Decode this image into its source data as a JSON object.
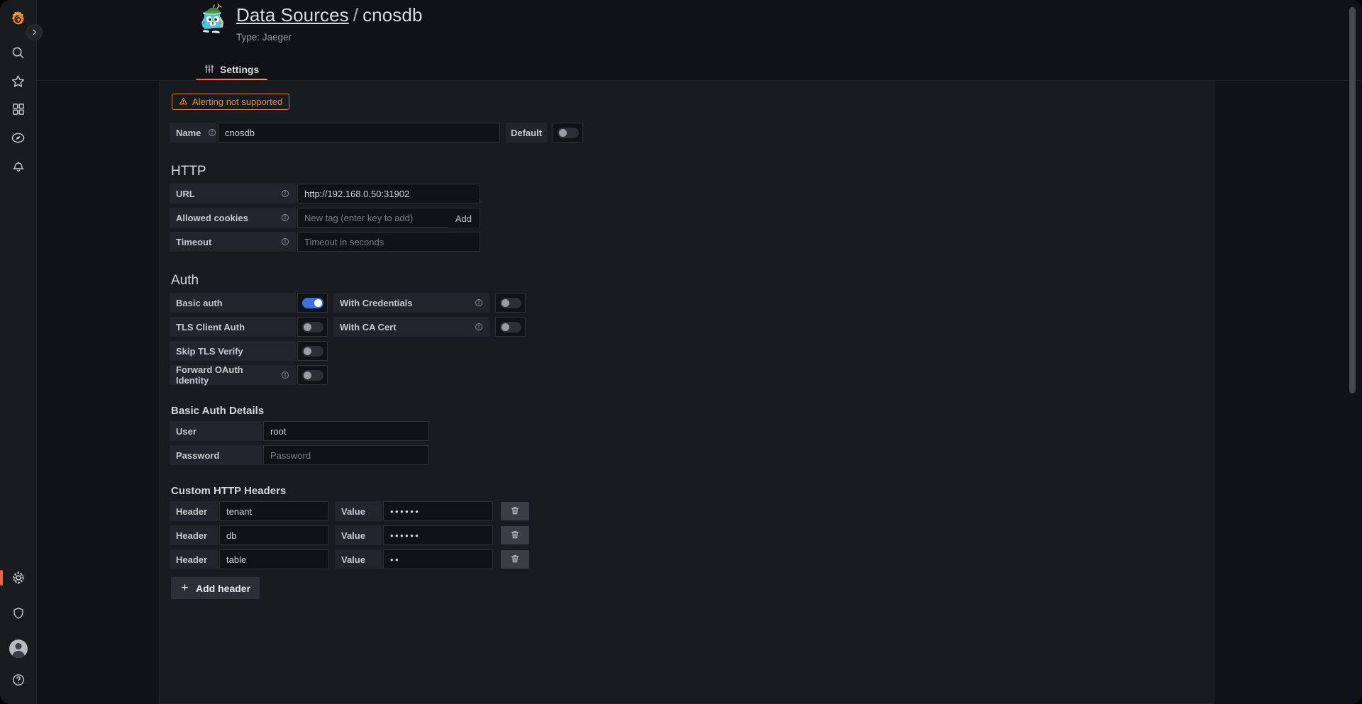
{
  "window": {
    "background": "#111217",
    "panel_bg": "#181b1f",
    "accent": "#f55f3e",
    "toggle_on_color": "#3d71d9",
    "warning_color": "#e8913c"
  },
  "sidebar": {
    "logo_name": "grafana-logo",
    "collapse_label": "›",
    "top_items": [
      {
        "name": "search-icon",
        "label": "Search"
      },
      {
        "name": "starred-icon",
        "label": "Starred"
      },
      {
        "name": "dashboards-icon",
        "label": "Dashboards"
      },
      {
        "name": "explore-compass-icon",
        "label": "Explore"
      },
      {
        "name": "alerting-bell-icon",
        "label": "Alerting"
      }
    ],
    "bottom_items": [
      {
        "name": "configuration-gear-icon",
        "label": "Configuration",
        "active": true
      },
      {
        "name": "shield-admin-icon",
        "label": "Server Admin",
        "active": false
      },
      {
        "name": "user-avatar",
        "label": "Profile",
        "active": false
      },
      {
        "name": "help-question-icon",
        "label": "Help",
        "active": false
      }
    ]
  },
  "header": {
    "logo_name": "jaeger-gopher-logo",
    "breadcrumb_parent": "Data Sources",
    "breadcrumb_separator": "/",
    "breadcrumb_current": "cnosdb",
    "type_label": "Type: Jaeger"
  },
  "tabs": [
    {
      "label": "Settings",
      "icon": "sliders-icon",
      "active": true
    }
  ],
  "alert": {
    "icon": "warning-triangle-icon",
    "text": "Alerting not supported"
  },
  "name_row": {
    "label": "Name",
    "info_icon": "info-circle-icon",
    "value": "cnosdb",
    "default_label": "Default",
    "default_toggle": "off"
  },
  "http": {
    "heading": "HTTP",
    "rows": [
      {
        "label": "URL",
        "info": true,
        "value": "http://192.168.0.50:31902",
        "placeholder": "",
        "is_placeholder": false
      },
      {
        "label": "Allowed cookies",
        "info": true,
        "value": "",
        "placeholder": "New tag (enter key to add)",
        "is_placeholder": true,
        "add_label": "Add"
      },
      {
        "label": "Timeout",
        "info": true,
        "value": "",
        "placeholder": "Timeout in seconds",
        "is_placeholder": true
      }
    ]
  },
  "auth": {
    "heading": "Auth",
    "rows": [
      {
        "label": "Basic auth",
        "info": false,
        "toggle": "on",
        "second_label": "With Credentials",
        "second_info": true,
        "second_toggle": "off"
      },
      {
        "label": "TLS Client Auth",
        "info": false,
        "toggle": "off",
        "second_label": "With CA Cert",
        "second_info": true,
        "second_toggle": "off"
      },
      {
        "label": "Skip TLS Verify",
        "info": false,
        "toggle": "off",
        "second_label": "",
        "second_info": false,
        "second_toggle": ""
      },
      {
        "label": "Forward OAuth Identity",
        "info": true,
        "toggle": "off",
        "second_label": "",
        "second_info": false,
        "second_toggle": ""
      }
    ]
  },
  "basic_auth_details": {
    "heading": "Basic Auth Details",
    "rows": [
      {
        "label": "User",
        "value": "root",
        "placeholder": "",
        "is_placeholder": false
      },
      {
        "label": "Password",
        "value": "",
        "placeholder": "Password",
        "is_placeholder": true
      }
    ]
  },
  "custom_headers": {
    "heading": "Custom HTTP Headers",
    "header_label": "Header",
    "value_label": "Value",
    "delete_icon": "trash-icon",
    "rows": [
      {
        "header": "tenant",
        "value": "••••••"
      },
      {
        "header": "db",
        "value": "••••••"
      },
      {
        "header": "table",
        "value": "••"
      }
    ],
    "add_button": {
      "icon": "plus-icon",
      "label": "Add header"
    }
  }
}
